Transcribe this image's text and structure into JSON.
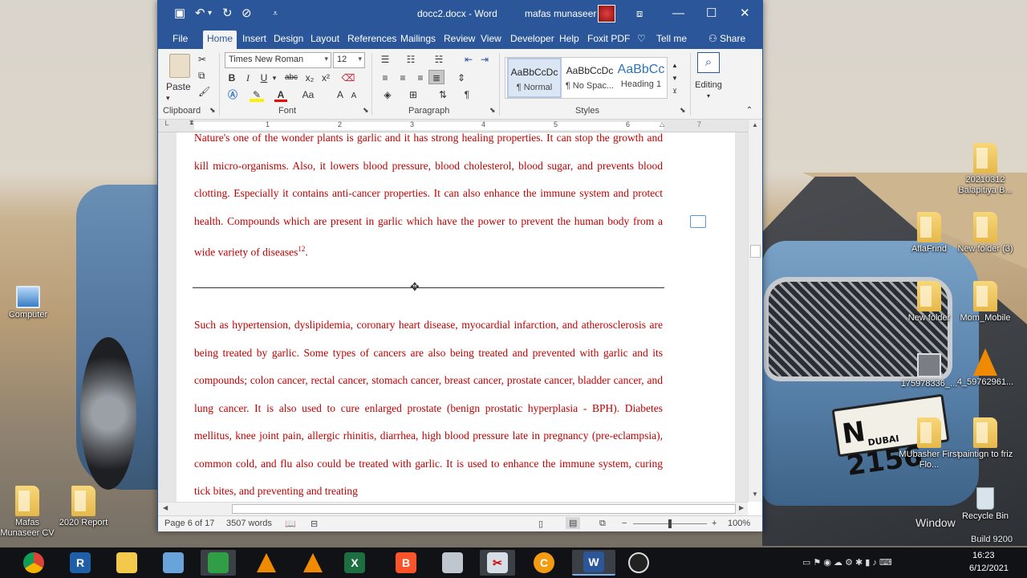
{
  "desktop": {
    "icons": [
      {
        "label": "Computer",
        "kind": "pc"
      },
      {
        "label": "Mafas Munaseer CV",
        "kind": "folder"
      },
      {
        "label": "2020 Report",
        "kind": "folder"
      },
      {
        "label": "20210312 Balapitiya B...",
        "kind": "folder"
      },
      {
        "label": "AflaFrind",
        "kind": "folder"
      },
      {
        "label": "New folder (3)",
        "kind": "folder"
      },
      {
        "label": "New folder",
        "kind": "folder"
      },
      {
        "label": "Mom_Mobile",
        "kind": "folder"
      },
      {
        "label": "175978336_...",
        "kind": "image"
      },
      {
        "label": "4_59762961...",
        "kind": "vlc"
      },
      {
        "label": "MUbasher First Flo...",
        "kind": "folder"
      },
      {
        "label": "paintign to friz",
        "kind": "folder"
      },
      {
        "label": "Recycle Bin",
        "kind": "bin"
      }
    ],
    "watermark_windows": "Window",
    "watermark_build": "Build 9200",
    "plate_text": "N 2156",
    "plate_sub": "DUBAI"
  },
  "word": {
    "title": "docc2.docx - Word",
    "user": "mafas munaseer",
    "tabs": [
      "File",
      "Home",
      "Insert",
      "Design",
      "Layout",
      "References",
      "Mailings",
      "Review",
      "View",
      "Developer",
      "Help",
      "Foxit PDF"
    ],
    "tell_me": "Tell me",
    "share": "Share",
    "ribbon": {
      "paste": "Paste",
      "clipboard": "Clipboard",
      "font_group": "Font",
      "paragraph_group": "Paragraph",
      "styles_group": "Styles",
      "editing": "Editing",
      "font_name": "Times New Roman",
      "font_size": "12",
      "bold": "B",
      "italic": "I",
      "underline": "U",
      "strike": "abc",
      "subscript": "x₂",
      "superscript": "x²",
      "font_color": "A",
      "change_case": "Aa",
      "grow": "A",
      "shrink": "A",
      "styles": [
        {
          "sample": "AaBbCcDc",
          "name": "¶ Normal"
        },
        {
          "sample": "AaBbCcDc",
          "name": "¶ No Spac..."
        },
        {
          "sample": "AaBbCc",
          "name": "Heading 1"
        }
      ]
    },
    "ruler_numbers": [
      "1",
      "2",
      "3",
      "4",
      "5",
      "6",
      "7"
    ],
    "paragraph1": "Nature's one of the wonder plants is garlic and it has strong healing properties. It can stop the growth and kill micro-organisms. Also, it lowers blood pressure, blood cholesterol, blood sugar, and prevents blood clotting. Especially it contains anti-cancer properties. It can also enhance the immune system and protect health. Compounds which are present in garlic which have the power to prevent the human body from a wide variety of diseases",
    "paragraph1_ref": "12",
    "paragraph1_end": ".",
    "paragraph2": "Such as hypertension, dyslipidemia, coronary heart disease, myocardial infarction, and atherosclerosis are being treated by garlic. Some types of cancers are also being treated and prevented with garlic and its compounds; colon cancer, rectal cancer, stomach cancer, breast cancer, prostate cancer, bladder cancer, and lung cancer. It is also used to cure enlarged prostate (benign prostatic hyperplasia - BPH). Diabetes mellitus, knee joint pain, allergic rhinitis, diarrhea, high blood pressure late in pregnancy (pre-eclampsia), common cold, and flu also could be treated with garlic. It is used to enhance the immune system, curing tick bites, and preventing and treating",
    "status": {
      "page": "Page 6 of 17",
      "words": "3507 words",
      "zoom": "100%",
      "zoom_level": 0.5
    }
  },
  "taskbar": {
    "apps": [
      "chrome",
      "remote",
      "file-explorer",
      "remote-desktop",
      "task-manager",
      "vlc",
      "vlc",
      "excel",
      "brave",
      "calculator",
      "snipping",
      "c-app",
      "word",
      "obs"
    ],
    "clock_time": "16:23",
    "clock_date": "6/12/2021"
  },
  "colors": {
    "word_blue": "#2b579a",
    "doc_text": "#c00000"
  }
}
